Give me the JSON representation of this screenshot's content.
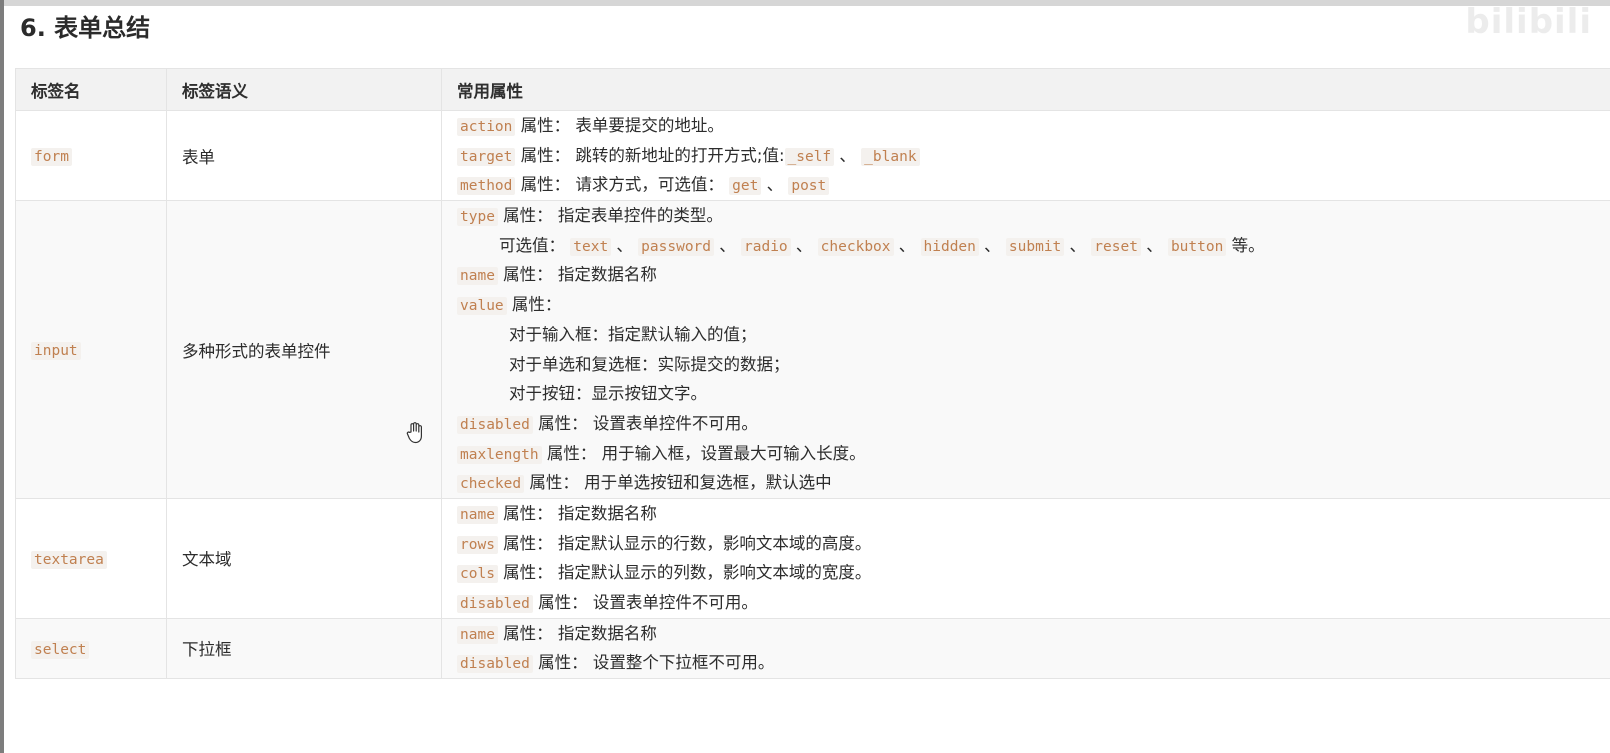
{
  "heading": "6. 表单总结",
  "watermark": "bilibili",
  "columns": [
    "标签名",
    "标签语义",
    "常用属性"
  ],
  "colors": {
    "code_text": "#c08050",
    "code_bg": "#f4f1ee",
    "header_bg": "#f2f2f2",
    "border": "#e4e4e4"
  },
  "rows": [
    {
      "tag": "form",
      "meaning": "表单",
      "attrs": [
        {
          "code": "action",
          "text": "属性： 表单要提交的地址。"
        },
        {
          "code": "target",
          "text": "属性： 跳转的新地址的打开方式;值:",
          "v1": "_self",
          "sep1": "、",
          "v2": "_blank"
        },
        {
          "code": "method",
          "text": "属性： 请求方式，可选值：",
          "v1": "get",
          "sep1": "、",
          "v2": "post"
        }
      ]
    },
    {
      "tag": "input",
      "meaning": "多种形式的表单控件",
      "attrs": [
        {
          "code": "type",
          "text": "属性： 指定表单控件的类型。"
        },
        {
          "prefix": "可选值：",
          "values": [
            "text",
            "password",
            "radio",
            "checkbox",
            "hidden",
            "submit",
            "reset",
            "button"
          ],
          "sep": "、",
          "suffix": "等。"
        },
        {
          "code": "name",
          "text": "属性： 指定数据名称"
        },
        {
          "code": "value",
          "text": "属性："
        },
        {
          "text": "对于输入框：指定默认输入的值；"
        },
        {
          "text": "对于单选和复选框：实际提交的数据；"
        },
        {
          "text": "对于按钮：显示按钮文字。"
        },
        {
          "code": "disabled",
          "text": "属性： 设置表单控件不可用。"
        },
        {
          "code": "maxlength",
          "text": "属性： 用于输入框，设置最大可输入长度。"
        },
        {
          "code": "checked",
          "text": "属性： 用于单选按钮和复选框，默认选中"
        }
      ]
    },
    {
      "tag": "textarea",
      "meaning": "文本域",
      "attrs": [
        {
          "code": "name",
          "text": "属性： 指定数据名称"
        },
        {
          "code": "rows",
          "text": "属性： 指定默认显示的行数，影响文本域的高度。"
        },
        {
          "code": "cols",
          "text": "属性： 指定默认显示的列数，影响文本域的宽度。"
        },
        {
          "code": "disabled",
          "text": "属性： 设置表单控件不可用。"
        }
      ]
    },
    {
      "tag": "select",
      "meaning": "下拉框",
      "attrs": [
        {
          "code": "name",
          "text": "属性： 指定数据名称"
        },
        {
          "code": "disabled",
          "text": "属性： 设置整个下拉框不可用。"
        }
      ]
    }
  ]
}
